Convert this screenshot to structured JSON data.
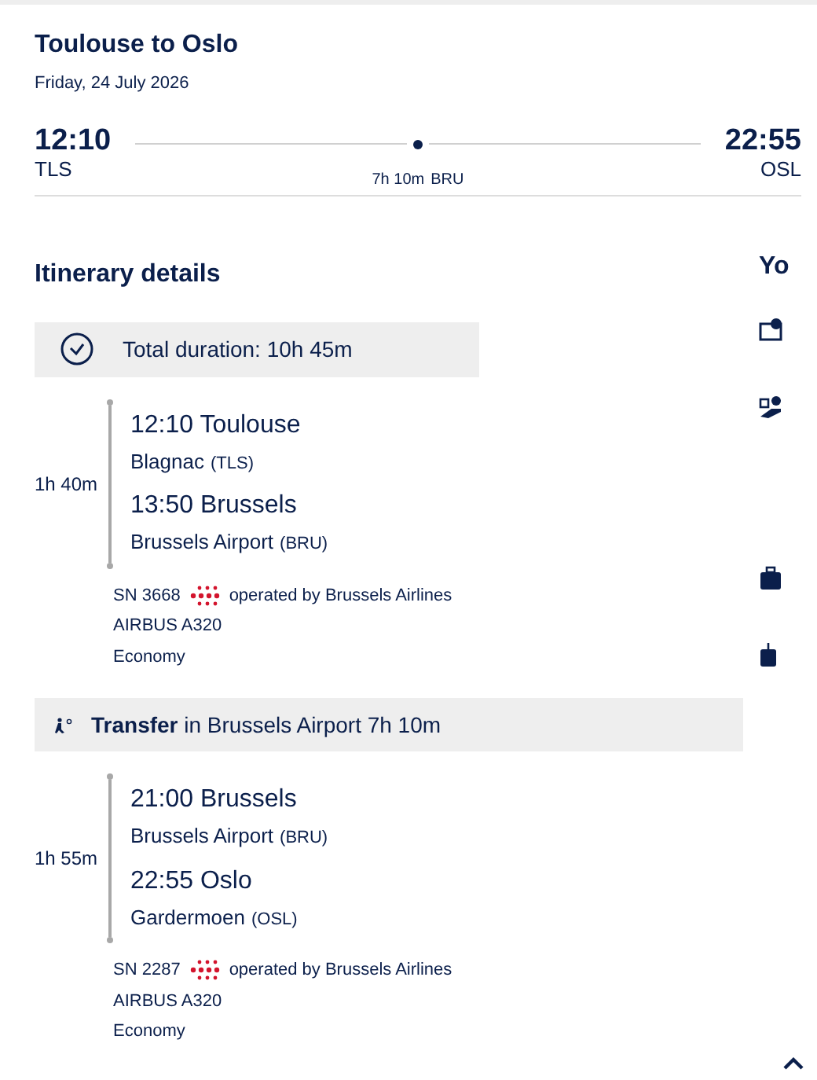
{
  "header": {
    "title": "Toulouse to Oslo",
    "date": "Friday, 24 July 2026",
    "departure": {
      "time": "12:10",
      "code": "TLS"
    },
    "arrival": {
      "time": "22:55",
      "code": "OSL"
    },
    "stop": {
      "duration": "7h 10m",
      "code": "BRU"
    }
  },
  "itinerary": {
    "title": "Itinerary details",
    "total": "Total duration: 10h 45m",
    "items": [
      {
        "kind": "flight",
        "duration": "1h 40m",
        "from": {
          "time_city": "12:10 Toulouse",
          "airport": "Blagnac",
          "code": "(TLS)"
        },
        "to": {
          "time_city": "13:50 Brussels",
          "airport": "Brussels Airport",
          "code": "(BRU)"
        },
        "flight_number": "SN 3668",
        "operator": "operated by Brussels Airlines",
        "aircraft": "AIRBUS A320",
        "cabin": "Economy"
      },
      {
        "kind": "transfer",
        "text": "**Transfer** in Brussels Airport 7h 10m"
      },
      {
        "kind": "flight",
        "duration": "1h 55m",
        "from": {
          "time_city": "21:00 Brussels",
          "airport": "Brussels Airport",
          "code": "(BRU)"
        },
        "to": {
          "time_city": "22:55 Oslo",
          "airport": "Gardermoen",
          "code": "(OSL)"
        },
        "flight_number": "SN 2287",
        "operator": "operated by Brussels Airlines",
        "aircraft": "AIRBUS A320",
        "cabin": "Economy"
      }
    ]
  },
  "side_panel": {
    "title": "Yo"
  }
}
